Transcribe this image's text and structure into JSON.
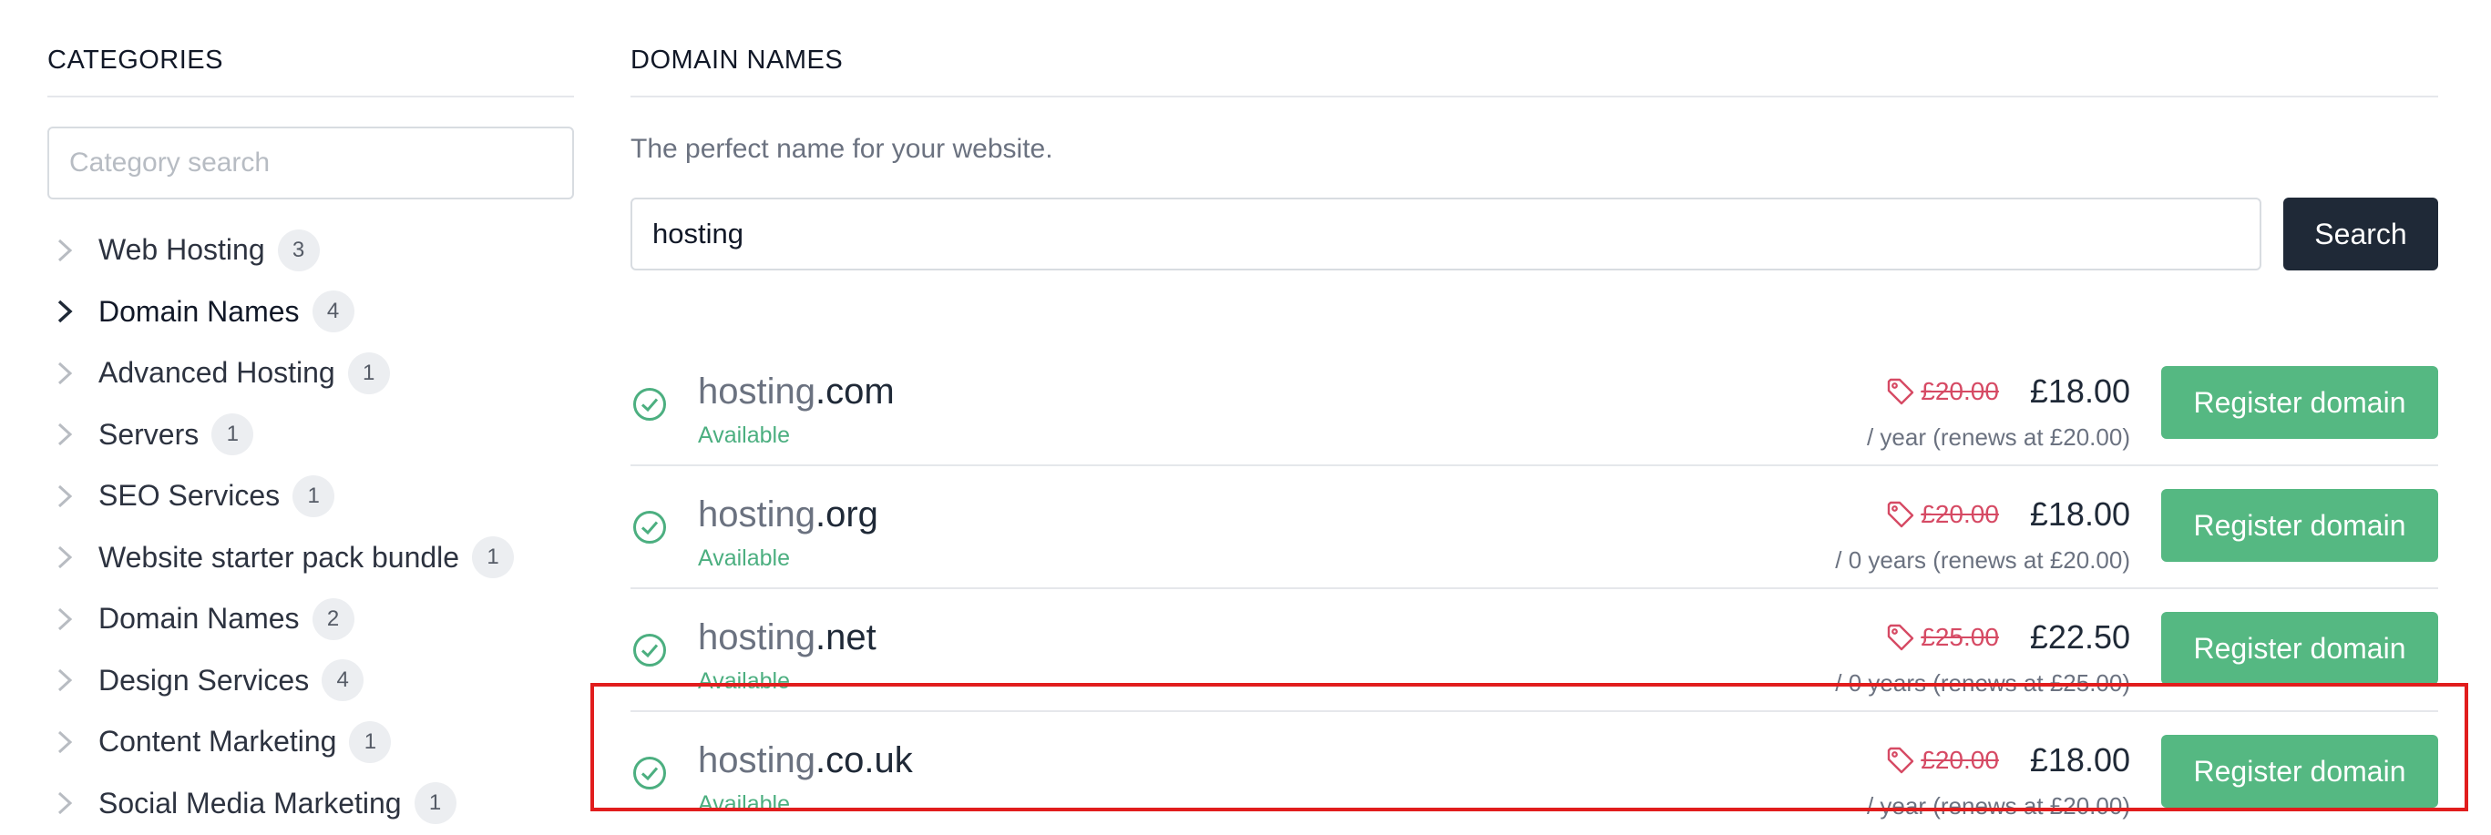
{
  "sidebar": {
    "title": "CATEGORIES",
    "search_placeholder": "Category search",
    "items": [
      {
        "label": "Web Hosting",
        "count": "3"
      },
      {
        "label": "Domain Names",
        "count": "4"
      },
      {
        "label": "Advanced Hosting",
        "count": "1"
      },
      {
        "label": "Servers",
        "count": "1"
      },
      {
        "label": "SEO Services",
        "count": "1"
      },
      {
        "label": "Website starter pack bundle",
        "count": "1"
      },
      {
        "label": "Domain Names",
        "count": "2"
      },
      {
        "label": "Design Services",
        "count": "4"
      },
      {
        "label": "Content Marketing",
        "count": "1"
      },
      {
        "label": "Social Media Marketing",
        "count": "1"
      }
    ]
  },
  "main": {
    "title": "DOMAIN NAMES",
    "subtitle": "The perfect name for your website.",
    "search_value": "hosting",
    "search_button": "Search",
    "results": [
      {
        "sld": "hosting",
        "tld": ".com",
        "status": "Available",
        "old_price": "£20.00",
        "price": "£18.00",
        "renew": "/ year (renews at £20.00)",
        "button": "Register domain"
      },
      {
        "sld": "hosting",
        "tld": ".org",
        "status": "Available",
        "old_price": "£20.00",
        "price": "£18.00",
        "renew": "/ 0 years (renews at £20.00)",
        "button": "Register domain"
      },
      {
        "sld": "hosting",
        "tld": ".net",
        "status": "Available",
        "old_price": "£25.00",
        "price": "£22.50",
        "renew": "/ 0 years (renews at £25.00)",
        "button": "Register domain"
      },
      {
        "sld": "hosting",
        "tld": ".co.uk",
        "status": "Available",
        "old_price": "£20.00",
        "price": "£18.00",
        "renew": "/ year (renews at £20.00)",
        "button": "Register domain"
      }
    ]
  },
  "colors": {
    "accent_green": "#55b882",
    "available_text": "#4caf80",
    "discount_red": "#d64a64",
    "dark_button": "#1f2937",
    "highlight": "#e11d1d"
  },
  "icons": {
    "chevron": "chevron-right-icon",
    "available": "check-circle-icon",
    "discount": "tag-icon"
  }
}
